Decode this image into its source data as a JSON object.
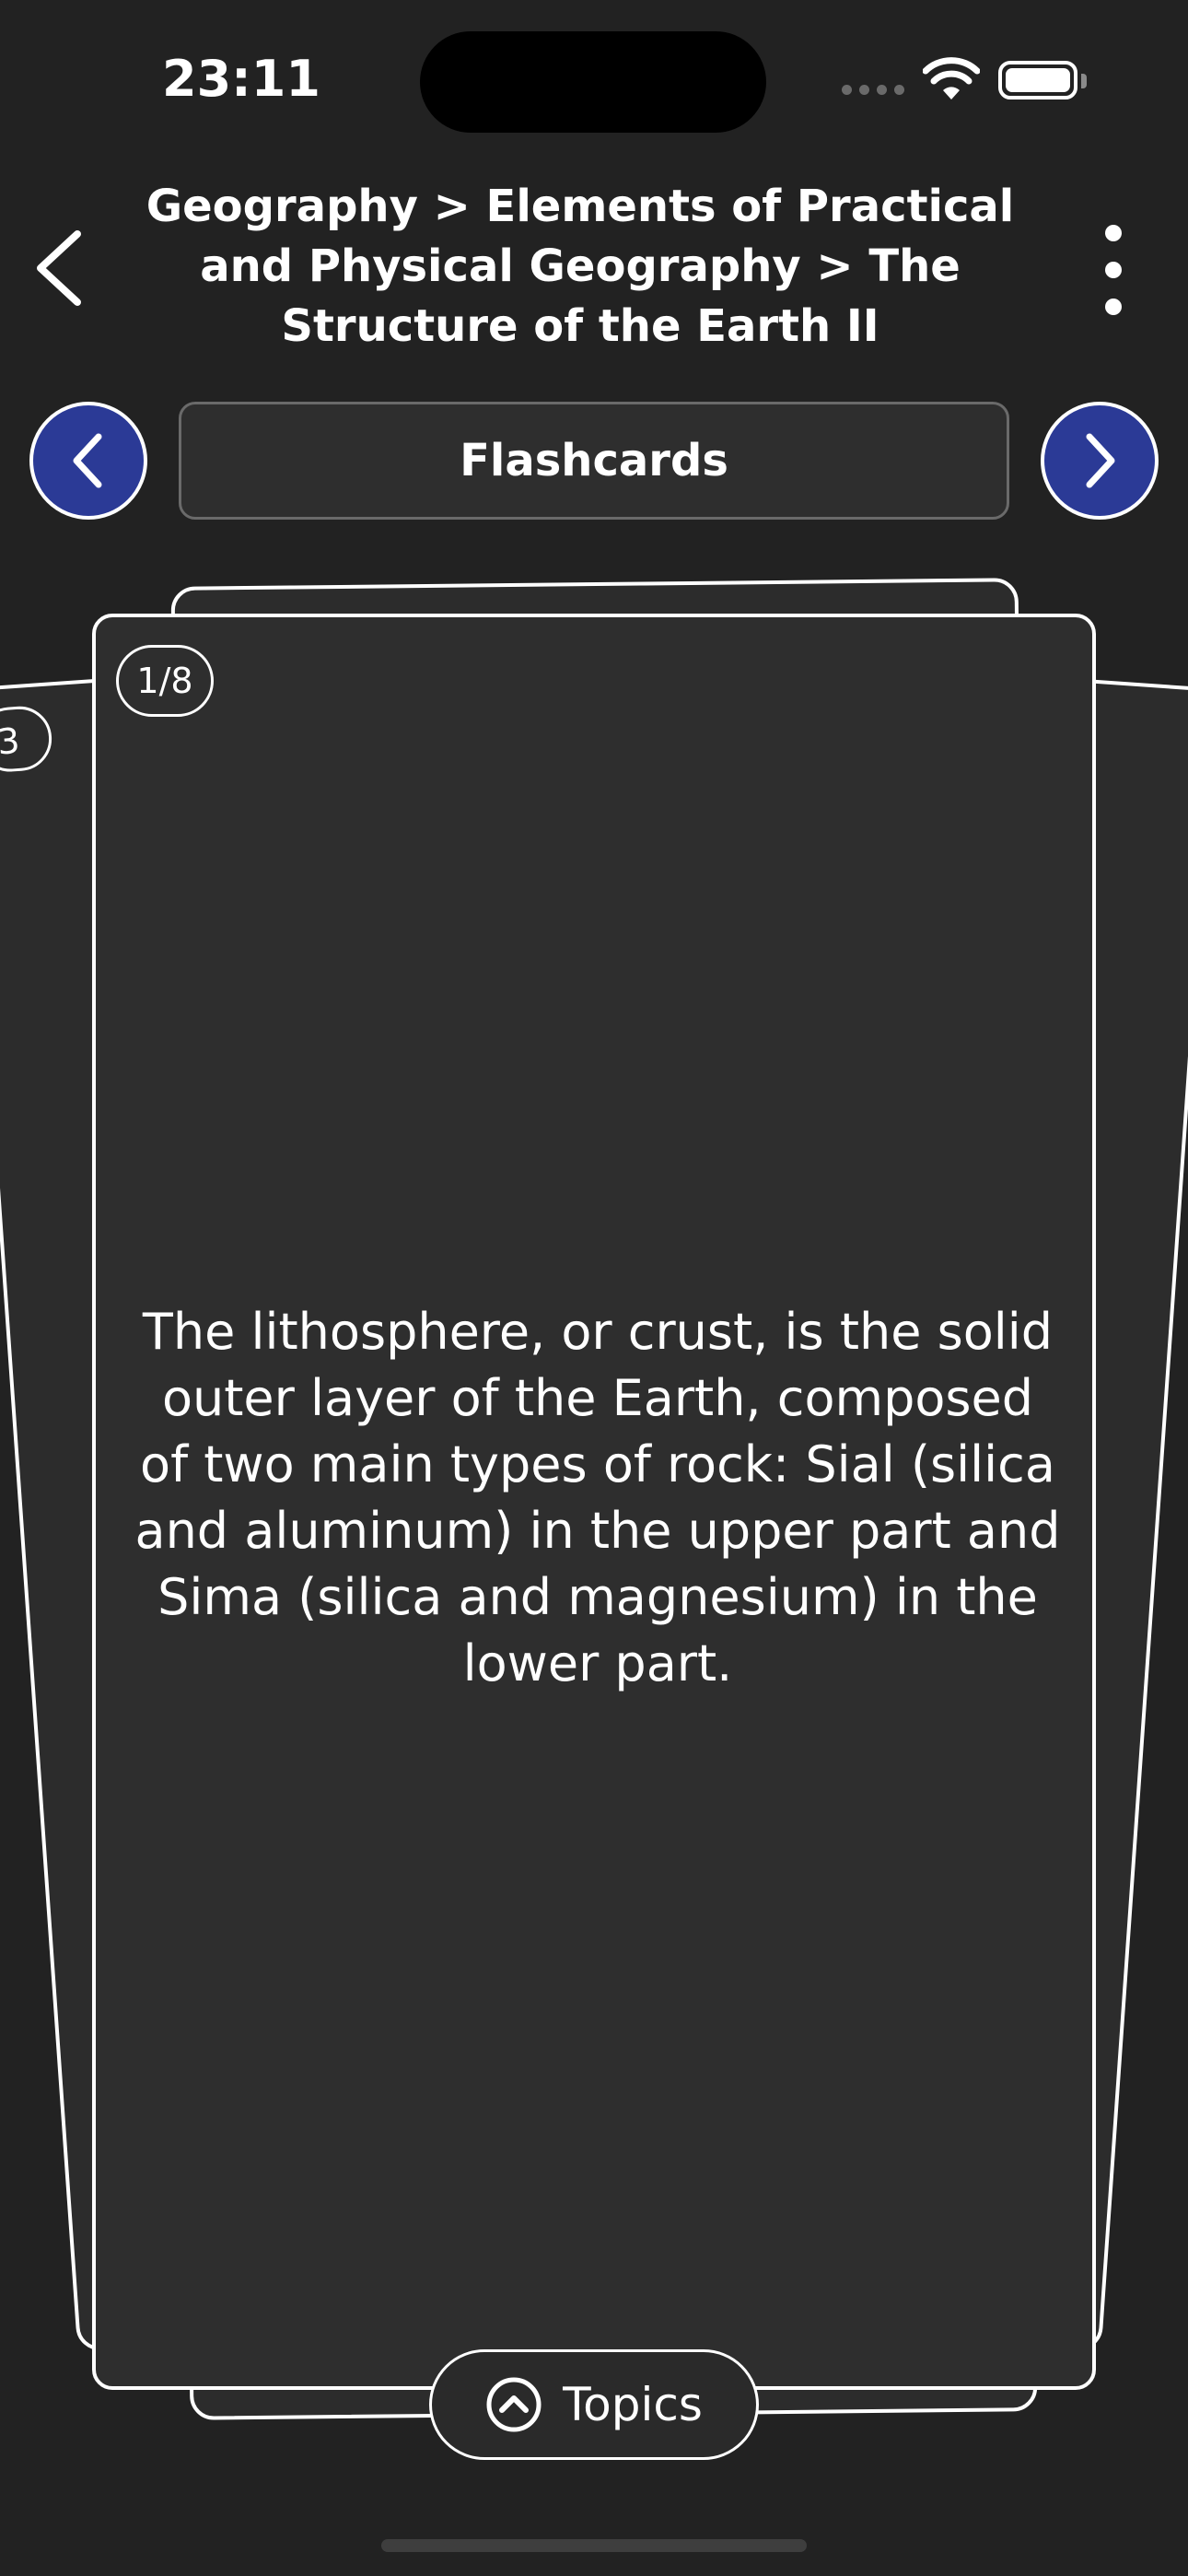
{
  "status_bar": {
    "time": "23:11"
  },
  "header": {
    "breadcrumb": "Geography > Elements of Practical and Physical Geography > The Structure of the Earth II",
    "back_icon": "chevron-left-icon",
    "more_icon": "vertical-dots-icon"
  },
  "mode": {
    "label": "Flashcards",
    "prev_icon": "chevron-left-icon",
    "next_icon": "chevron-right-icon"
  },
  "card": {
    "counter": "1/8",
    "behind_counter": "3",
    "text": "The lithosphere, or crust, is the solid outer layer of the Earth, composed of two main types of rock: Sial (silica and aluminum) in the upper part and Sima (silica and magnesium) in the lower part."
  },
  "topics": {
    "label": "Topics",
    "icon": "chevron-up-circle-icon"
  },
  "colors": {
    "background": "#222222",
    "card": "#2e2e2e",
    "accent": "#2b3a96"
  }
}
